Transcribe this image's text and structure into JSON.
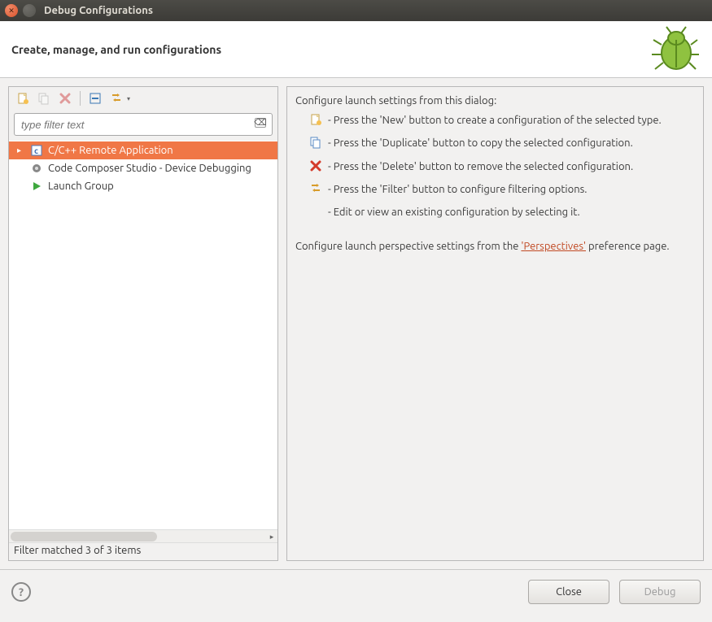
{
  "window": {
    "title": "Debug Configurations"
  },
  "header": {
    "title": "Create, manage, and run configurations"
  },
  "filter": {
    "placeholder": "type filter text"
  },
  "tree": {
    "items": [
      {
        "label": "C/C++ Remote Application",
        "icon": "c-file",
        "selected": true
      },
      {
        "label": "Code Composer Studio - Device Debugging",
        "icon": "gear",
        "selected": false
      },
      {
        "label": "Launch Group",
        "icon": "play",
        "selected": false
      }
    ]
  },
  "filter_status": "Filter matched 3 of 3 items",
  "right": {
    "intro": "Configure launch settings from this dialog:",
    "lines": {
      "new": " - Press the 'New' button to create a configuration of the selected type.",
      "dup": " - Press the 'Duplicate' button to copy the selected configuration.",
      "del": " - Press the 'Delete' button to remove the selected configuration.",
      "filter": " - Press the 'Filter' button to configure filtering options.",
      "edit": " - Edit or view an existing configuration by selecting it."
    },
    "persp_pre": "Configure launch perspective settings from the ",
    "persp_link": "'Perspectives'",
    "persp_post": " preference page."
  },
  "footer": {
    "close": "Close",
    "debug": "Debug"
  }
}
